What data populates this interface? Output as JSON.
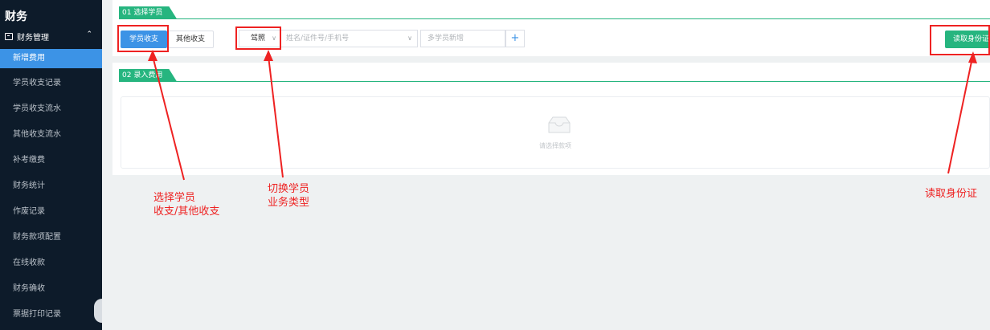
{
  "sidebar": {
    "title": "财务",
    "group": {
      "icon": "finance-box-icon",
      "label": "财务管理",
      "caret": "⌃"
    },
    "items": [
      {
        "label": "新增费用",
        "active": true
      },
      {
        "label": "学员收支记录"
      },
      {
        "label": "学员收支流水"
      },
      {
        "label": "其他收支流水"
      },
      {
        "label": "补考缴费"
      },
      {
        "label": "财务统计"
      },
      {
        "label": "作废记录"
      },
      {
        "label": "财务款项配置"
      },
      {
        "label": "在线收款"
      },
      {
        "label": "财务确收"
      },
      {
        "label": "票据打印记录"
      }
    ]
  },
  "section1": {
    "tag": "01 选择学员",
    "student_tab": "学员收支",
    "other_tab": "其他收支",
    "type_select": "驾照",
    "search_placeholder": "姓名/证件号/手机号",
    "multi_placeholder": "多学员新增",
    "add_symbol": "+",
    "read_id_button": "读取身份证"
  },
  "section2": {
    "tag": "02 录入费用",
    "empty_text": "请选择款项"
  },
  "annotations": {
    "left": "选择学员\n收支/其他收支",
    "middle": "切换学员\n业务类型",
    "right": "读取身份证"
  },
  "colors": {
    "accent_blue": "#3c93e6",
    "accent_green": "#26b57f",
    "annotation_red": "#ee2222",
    "sidebar_bg": "#0d1b2a"
  }
}
